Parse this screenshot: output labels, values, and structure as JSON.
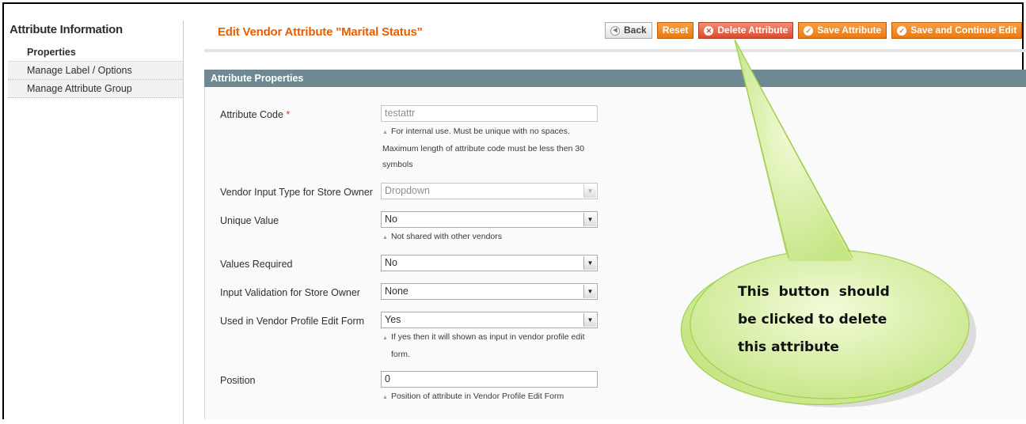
{
  "sidebar": {
    "title": "Attribute Information",
    "items": [
      {
        "label": "Properties"
      },
      {
        "label": "Manage Label / Options"
      },
      {
        "label": "Manage Attribute Group"
      }
    ]
  },
  "header": {
    "title": "Edit Vendor Attribute \"Marital Status\"",
    "buttons": {
      "back": "Back",
      "reset": "Reset",
      "delete": "Delete Attribute",
      "save": "Save Attribute",
      "save_continue": "Save and Continue Edit"
    }
  },
  "section": {
    "title": "Attribute Properties",
    "attribute_code": {
      "label": "Attribute Code",
      "required_mark": "*",
      "value": "testattr",
      "note_lines": [
        "For internal use. Must be unique with no spaces.",
        "Maximum length of attribute code must be less then 30",
        "symbols"
      ]
    },
    "input_type": {
      "label": "Vendor Input Type for Store Owner",
      "value": "Dropdown"
    },
    "unique_value": {
      "label": "Unique Value",
      "value": "No",
      "note": "Not shared with other vendors"
    },
    "values_required": {
      "label": "Values Required",
      "value": "No"
    },
    "input_validation": {
      "label": "Input Validation for Store Owner",
      "value": "None"
    },
    "used_in_profile": {
      "label": "Used in Vendor Profile Edit Form",
      "value": "Yes",
      "note_lines": [
        "If yes then it will shown as input in vendor profile edit",
        "form."
      ]
    },
    "position": {
      "label": "Position",
      "value": "0",
      "note": "Position of attribute in Vendor Profile Edit Form"
    }
  },
  "callout": {
    "lines": [
      "This button should",
      "be clicked to delete",
      "this attribute"
    ]
  },
  "colors": {
    "title_orange": "#eb5e00",
    "button_orange": "#ea7a12",
    "delete_red": "#dc4a2b",
    "section_header": "#6f8992",
    "callout_green": "#cdeb8b"
  },
  "icons": {
    "back": "back-arrow-icon",
    "delete": "delete-circle-icon",
    "save": "check-circle-icon",
    "select": "chevron-down-icon",
    "note": "triangle-up-icon"
  }
}
